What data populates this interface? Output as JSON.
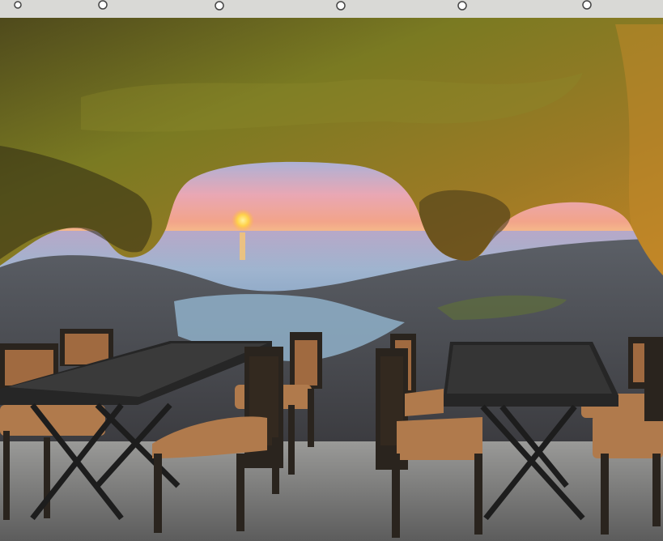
{
  "scene": {
    "subject": "cave-sunset-mural-with-dining-tables",
    "colors": {
      "ceiling_strip": "#d9d9d6",
      "sky_top": "#8fb6e6",
      "sky_horizon": "#f2a48a",
      "sun": "#ffd24a",
      "sea": "#8fb0cf",
      "rock_dark": "#3b2f18",
      "rock_moss": "#7a7a22",
      "rock_gold": "#b8861f",
      "shore": "#4a4f57",
      "floor": "#6f6f6f",
      "table_top": "#262626",
      "chair_frame": "#2a241e",
      "chair_cushion": "#b07a4c"
    },
    "lights_count": 6,
    "tables_count": 2
  }
}
